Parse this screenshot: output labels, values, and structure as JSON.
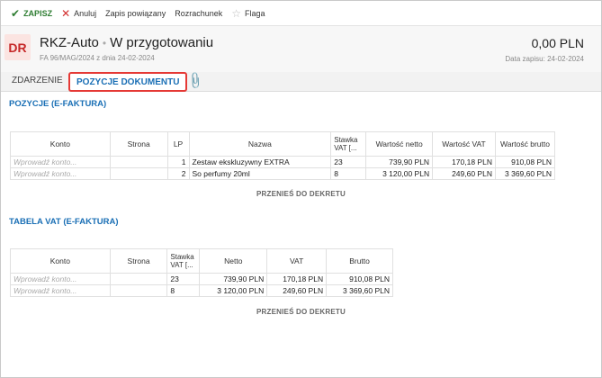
{
  "toolbar": {
    "save": "ZAPISZ",
    "cancel": "Anuluj",
    "related": "Zapis powiązany",
    "settlement": "Rozrachunek",
    "flag": "Flaga"
  },
  "header": {
    "avatar": "DR",
    "doc_type": "RKZ-Auto",
    "separator": "•",
    "status": "W przygotowaniu",
    "subtitle": "FA 96/MAG/2024 z dnia 24-02-2024",
    "amount": "0,00 PLN",
    "save_date": "Data zapisu: 24-02-2024"
  },
  "tabs": {
    "event": "ZDARZENIE",
    "items": "POZYCJE DOKUMENTU",
    "attachment_icon": "paperclip-icon"
  },
  "positions": {
    "title": "POZYCJE (E-FAKTURA)",
    "headers": {
      "konto": "Konto",
      "strona": "Strona",
      "lp": "LP",
      "nazwa": "Nazwa",
      "stawka_1": "Stawka",
      "stawka_2": "VAT [...",
      "netto": "Wartość netto",
      "vat": "Wartość VAT",
      "brutto": "Wartość brutto"
    },
    "rows": [
      {
        "konto": "Wprowadź konto...",
        "strona": "",
        "lp": "1",
        "nazwa": "Zestaw ekskluzywny EXTRA",
        "stawka": "23",
        "netto": "739,90 PLN",
        "vat": "170,18 PLN",
        "brutto": "910,08 PLN"
      },
      {
        "konto": "Wprowadź konto...",
        "strona": "",
        "lp": "2",
        "nazwa": "So perfumy 20ml",
        "stawka": "8",
        "netto": "3 120,00 PLN",
        "vat": "249,60 PLN",
        "brutto": "3 369,60 PLN"
      }
    ],
    "dekret": "PRZENIEŚ DO DEKRETU"
  },
  "vat_table": {
    "title": "TABELA VAT (E-FAKTURA)",
    "headers": {
      "konto": "Konto",
      "strona": "Strona",
      "stawka_1": "Stawka",
      "stawka_2": "VAT [...",
      "netto": "Netto",
      "vat": "VAT",
      "brutto": "Brutto"
    },
    "rows": [
      {
        "konto": "Wprowadź konto...",
        "strona": "",
        "stawka": "23",
        "netto": "739,90 PLN",
        "vat": "170,18 PLN",
        "brutto": "910,08 PLN"
      },
      {
        "konto": "Wprowadź konto...",
        "strona": "",
        "stawka": "8",
        "netto": "3 120,00 PLN",
        "vat": "249,60 PLN",
        "brutto": "3 369,60 PLN"
      }
    ],
    "dekret": "PRZENIEŚ DO DEKRETU"
  }
}
